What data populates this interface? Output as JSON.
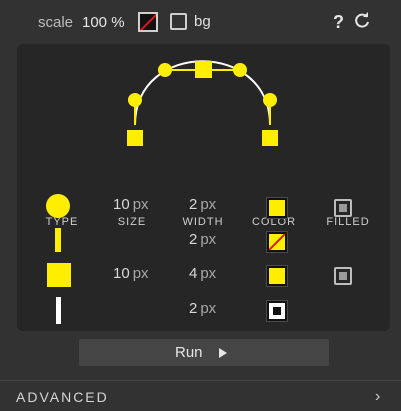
{
  "toolbar": {
    "scale_label": "scale",
    "scale_value": "100 %",
    "bg_label": "bg",
    "help_glyph": "?",
    "help_icon": "question-icon",
    "refresh_icon": "refresh-icon"
  },
  "preview": {
    "icon": "bezier-curve-preview",
    "color": "#ffee00"
  },
  "table": {
    "headers": {
      "type": "TYPE",
      "size": "SIZE",
      "width": "WIDTH",
      "color": "COLOR",
      "filled": "FILLED"
    },
    "unit": "px",
    "rows": [
      {
        "type_icon": "circle-handle-icon",
        "size": "10",
        "width": "2",
        "color": "#ffee00",
        "filled": true
      },
      {
        "type_icon": "line-bar-icon",
        "size": "",
        "width": "2",
        "color": "none",
        "filled": false
      },
      {
        "type_icon": "square-handle-icon",
        "size": "10",
        "width": "4",
        "color": "#ffee00",
        "filled": true
      },
      {
        "type_icon": "white-line-icon",
        "size": "",
        "width": "2",
        "color": "#ffffff",
        "filled": false
      }
    ]
  },
  "run": {
    "label": "Run",
    "icon": "play-icon"
  },
  "advanced": {
    "label": "ADVANCED",
    "icon": "chevron-right-icon"
  },
  "colors": {
    "accent": "#ffee00",
    "background": "#323232",
    "panel": "#262626",
    "none_slash": "#e01818"
  }
}
